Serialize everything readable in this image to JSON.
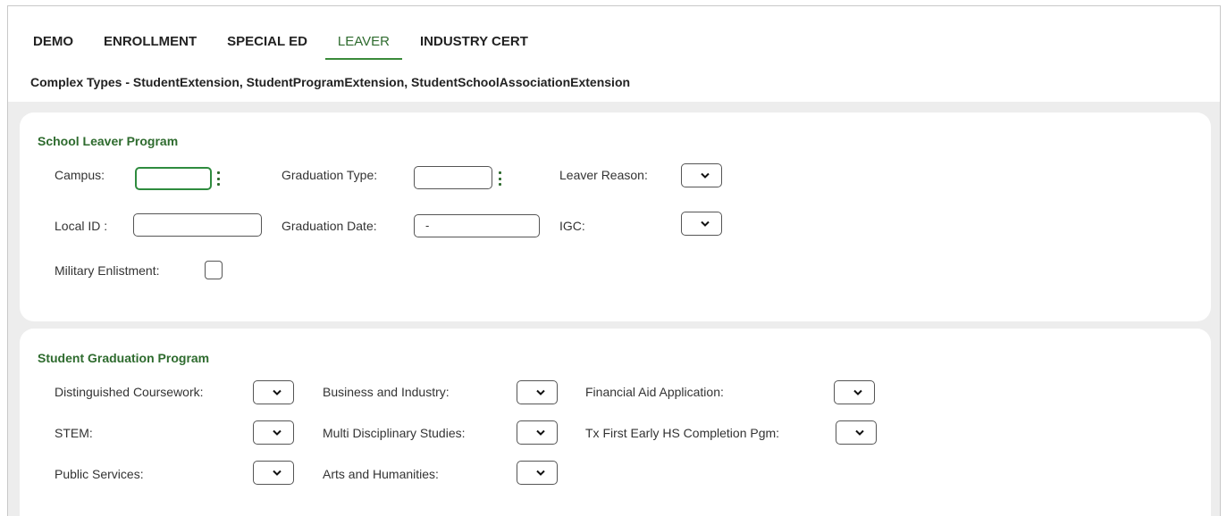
{
  "tabs": [
    {
      "label": "DEMO"
    },
    {
      "label": "ENROLLMENT"
    },
    {
      "label": "SPECIAL ED"
    },
    {
      "label": "LEAVER",
      "active": true
    },
    {
      "label": "INDUSTRY CERT"
    }
  ],
  "complex_types": "Complex Types - StudentExtension, StudentProgramExtension, StudentSchoolAssociationExtension",
  "leaver": {
    "title": "School Leaver Program",
    "campus_label": "Campus:",
    "campus_value": "",
    "graduation_type_label": "Graduation Type:",
    "graduation_type_value": "",
    "leaver_reason_label": "Leaver Reason:",
    "local_id_label": "Local ID :",
    "local_id_value": "",
    "graduation_date_label": "Graduation Date:",
    "graduation_date_value": "-",
    "igc_label": "IGC:",
    "military_label": "Military Enlistment:"
  },
  "graduation": {
    "title": "Student Graduation Program",
    "distinguished_label": "Distinguished Coursework:",
    "business_label": "Business and Industry:",
    "financial_label": "Financial Aid Application:",
    "stem_label": "STEM:",
    "multi_label": "Multi Disciplinary Studies:",
    "txfirst_label": "Tx First Early HS Completion Pgm:",
    "public_label": "Public Services:",
    "arts_label": "Arts and Humanities:"
  },
  "colors": {
    "accent": "#2e6b2e",
    "focus": "#2e8b3e",
    "panel_bg": "#ededed"
  },
  "icons": {
    "dropdown": "chevron-down-icon",
    "lookup": "kebab-menu-icon"
  }
}
